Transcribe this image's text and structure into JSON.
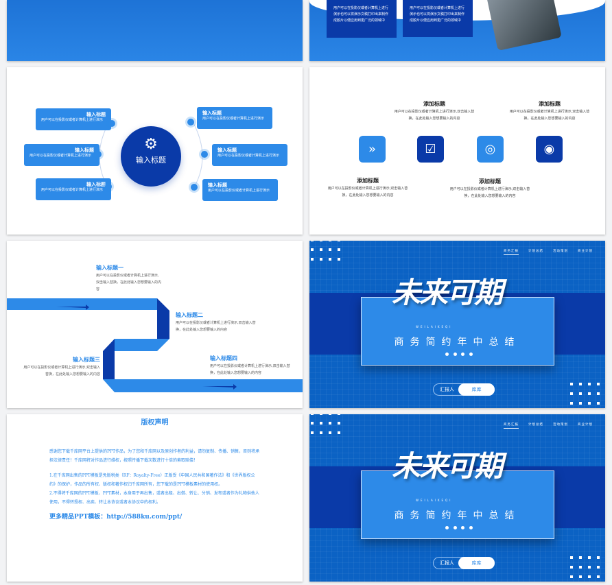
{
  "slide1": {
    "card_text": "用户可以在投影仪或者计算机上进行演示也可以将演示文稿打印出来制作成胶片以便应用到更广泛的领域中"
  },
  "slide2": {
    "center_title": "输入标题",
    "items": [
      {
        "title": "输入标题",
        "text": "用户可以在投影仪或者计算机上进行演示"
      },
      {
        "title": "输入标题",
        "text": "用户可以在投影仪或者计算机上进行演示"
      },
      {
        "title": "输入标题",
        "text": "用户可以在投影仪或者计算机上进行演示"
      },
      {
        "title": "输入标题",
        "text": "用户可以在投影仪或者计算机上进行演示"
      },
      {
        "title": "输入标题",
        "text": "用户可以在投影仪或者计算机上进行演示"
      },
      {
        "title": "输入标题",
        "text": "用户可以在投影仪或者计算机上进行演示"
      }
    ]
  },
  "slide3": {
    "items": [
      {
        "title": "添加标题",
        "text": "用户可以在投影仪或者计算机上进行演示,双击输入替换，在此处输入您想要输入的内容"
      },
      {
        "title": "添加标题",
        "text": "用户可以在投影仪或者计算机上进行演示,双击输入替换，在此处输入您想要输入的内容"
      },
      {
        "title": "添加标题",
        "text": "用户可以在投影仪或者计算机上进行演示,双击输入替换，在此处输入您想要输入的内容"
      },
      {
        "title": "添加标题",
        "text": "用户可以在投影仪或者计算机上进行演示,双击输入替换，在此处输入您想要输入的内容"
      }
    ],
    "icons": [
      "double-chevron-right-icon",
      "clipboard-search-icon",
      "target-person-icon",
      "target-icon"
    ],
    "colors": {
      "light": "#2d8ae8",
      "dark": "#0a3aa8"
    }
  },
  "slide4": {
    "steps": [
      {
        "title": "输入标题一",
        "text": "用户可以在投影仪或者计算机上进行演示,双击输入替换，在此处输入您想要输入的内容"
      },
      {
        "title": "输入标题二",
        "text": "用户可以在投影仪或者计算机上进行演示,双击输入替换，在此处输入您想要输入的内容"
      },
      {
        "title": "输入标题三",
        "text": "用户可以在投影仪或者计算机上进行演示,双击输入替换，在此处输入您想要输入的内容"
      },
      {
        "title": "输入标题四",
        "text": "用户可以在投影仪或者计算机上进行演示,双击输入替换，在此处输入您想要输入的内容"
      }
    ]
  },
  "cover": {
    "nav": [
      "商务汇报",
      "计划总结",
      "活动策划",
      "商业计划"
    ],
    "title": "未来可期",
    "pinyin": "WEILAIKEQI",
    "subtitle": "商务简约年中总结",
    "reporter_label": "汇报人",
    "reporter_name": "库库"
  },
  "copyright": {
    "title": "版权声明",
    "p1": "感谢您下载千库网平台上提供的PPT作品，为了您和千库网以及原创作者的利益，请勿复制、传播、销售，否则将承担法律责任！千库网将对作品进行维权，按照传播下载次数进行十倍的索取赔偿！",
    "p2": "1.在千库网出售的PPT模板是免版税类（RF：Royalty-Free）正版受《中国人民共和国著作法》和《世界版权公约》的保护，作品的所有权、版权和著作权归千库网所有，您下载的是PPT模板素材的使用权。",
    "p3": "2.不得将千库网的PPT模板、PPT素材，本身用于再出售，或者出租、出借、转让、分销、发布或者作为礼物供他人使用，不得转授权、出卖、转让本协议或者本协议中的权利。",
    "more": "更多精品PPT模板：http://588ku.com/ppt/"
  }
}
